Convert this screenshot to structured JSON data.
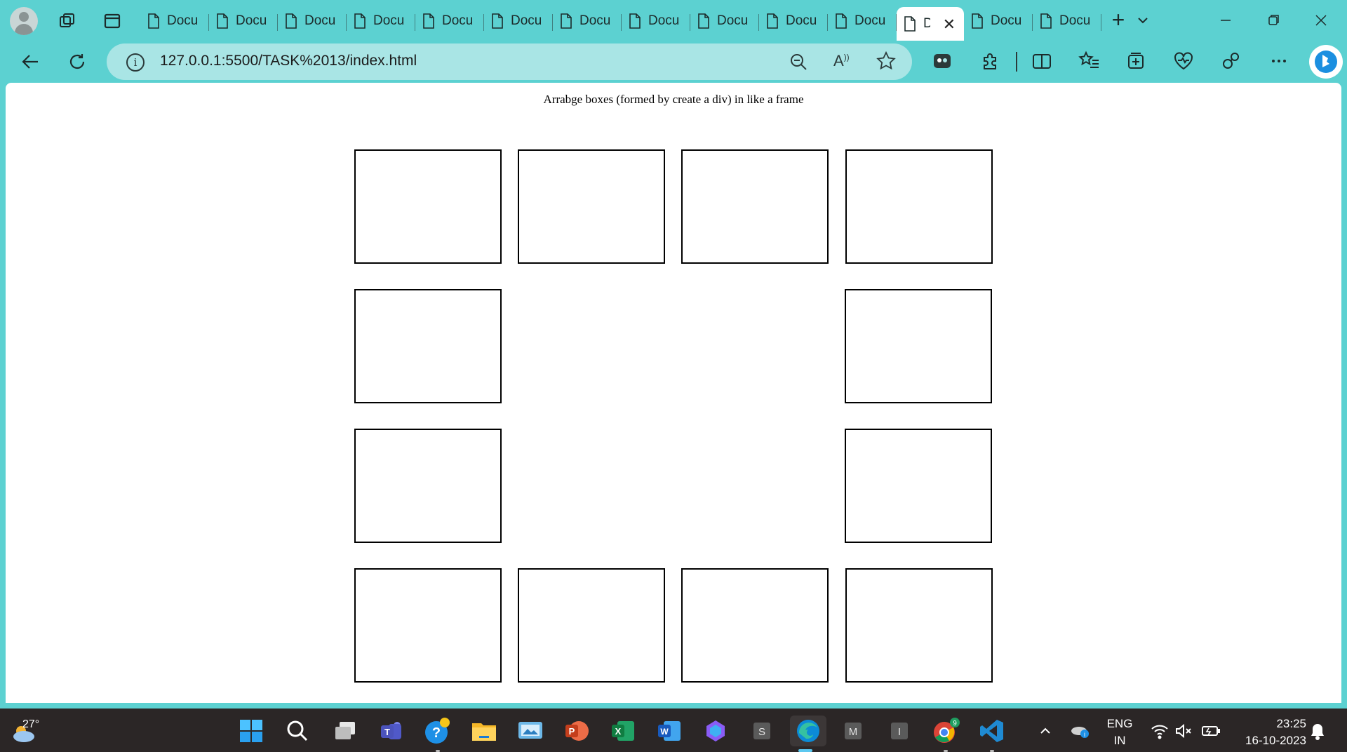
{
  "browser": {
    "tabs": [
      {
        "label": "Docu"
      },
      {
        "label": "Docu"
      },
      {
        "label": "Docu"
      },
      {
        "label": "Docu"
      },
      {
        "label": "Docu"
      },
      {
        "label": "Docu"
      },
      {
        "label": "Docu"
      },
      {
        "label": "Docu"
      },
      {
        "label": "Docu"
      },
      {
        "label": "Docu"
      },
      {
        "label": "Docu"
      },
      {
        "label": "D",
        "active": true
      },
      {
        "label": "Docu"
      },
      {
        "label": "Docu"
      }
    ],
    "url": "127.0.0.1:5500/TASK%2013/index.html",
    "read_aloud_label": "A",
    "accent_color": "#5cd1d1"
  },
  "page": {
    "heading": "Arrabge boxes (formed by create a div) in like a frame",
    "box_grid": {
      "rows": 4,
      "cols": 4,
      "filled": "perimeter",
      "box_count": 12
    }
  },
  "taskbar": {
    "weather_temp": "27°",
    "apps": [
      "start-icon",
      "search-icon",
      "task-view-icon",
      "teams-icon",
      "tips-icon",
      "file-explorer-icon",
      "photos-icon",
      "powerpoint-icon",
      "excel-icon",
      "word-icon",
      "copilot-icon",
      "s-app-icon",
      "edge-icon",
      "m-app-icon",
      "i-app-icon",
      "chrome-icon",
      "vscode-icon"
    ],
    "chrome_badge": "9",
    "language": "ENG",
    "region": "IN",
    "time": "23:25",
    "date": "16-10-2023"
  }
}
